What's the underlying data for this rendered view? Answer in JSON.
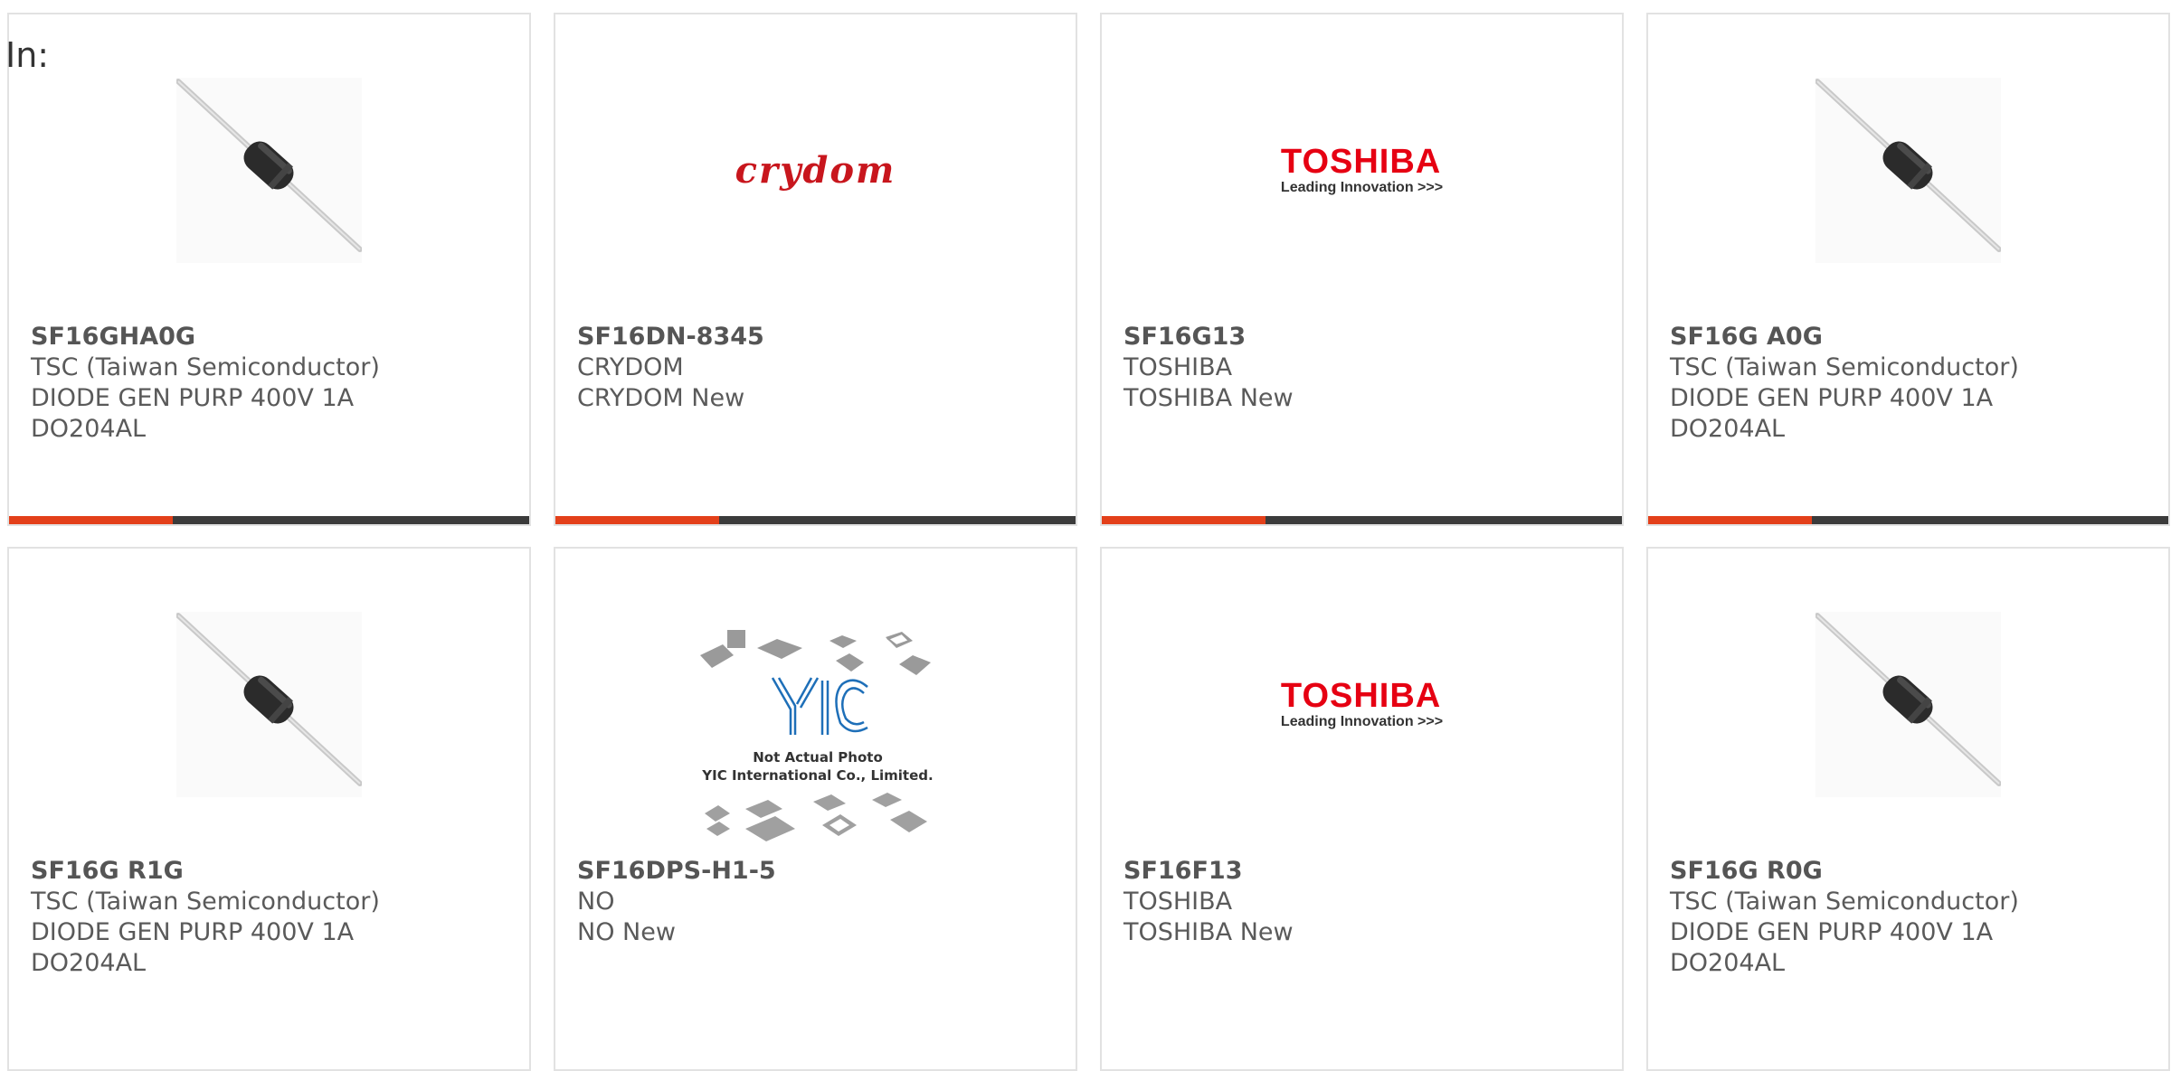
{
  "filter": {
    "label": "In:"
  },
  "cards": [
    {
      "part": "SF16GHA0G",
      "lines": [
        "TSC (Taiwan Semiconductor)",
        "DIODE GEN PURP 400V 1A",
        "DO204AL"
      ],
      "image": "diode-icon"
    },
    {
      "part": "SF16DN-8345",
      "lines": [
        "CRYDOM",
        "CRYDOM New"
      ],
      "image": "crydom-logo",
      "logo_text": "crydom"
    },
    {
      "part": "SF16G13",
      "lines": [
        "TOSHIBA",
        "TOSHIBA New"
      ],
      "image": "toshiba-logo",
      "logo_text": "TOSHIBA",
      "logo_tagline": "Leading Innovation >>>"
    },
    {
      "part": "SF16G A0G",
      "lines": [
        "TSC (Taiwan Semiconductor)",
        "DIODE GEN PURP 400V 1A",
        "DO204AL"
      ],
      "image": "diode-icon"
    },
    {
      "part": "SF16G R1G",
      "lines": [
        "TSC (Taiwan Semiconductor)",
        "DIODE GEN PURP 400V 1A",
        "DO204AL"
      ],
      "image": "diode-icon"
    },
    {
      "part": "SF16DPS-H1-5",
      "lines": [
        "NO",
        "NO New"
      ],
      "image": "yic-placeholder",
      "photo_note_1": "Not Actual Photo",
      "photo_note_2": "YIC International Co., Limited."
    },
    {
      "part": "SF16F13",
      "lines": [
        "TOSHIBA",
        "TOSHIBA New"
      ],
      "image": "toshiba-logo",
      "logo_text": "TOSHIBA",
      "logo_tagline": "Leading Innovation >>>"
    },
    {
      "part": "SF16G R0G",
      "lines": [
        "TSC (Taiwan Semiconductor)",
        "DIODE GEN PURP 400V 1A",
        "DO204AL"
      ],
      "image": "diode-icon"
    }
  ],
  "colors": {
    "accent": "#e3401a",
    "bar": "#3b3b3b",
    "border": "#e2e2e2",
    "crydom": "#c8161d",
    "toshiba": "#e60012",
    "yic": "#1e6fb8"
  }
}
